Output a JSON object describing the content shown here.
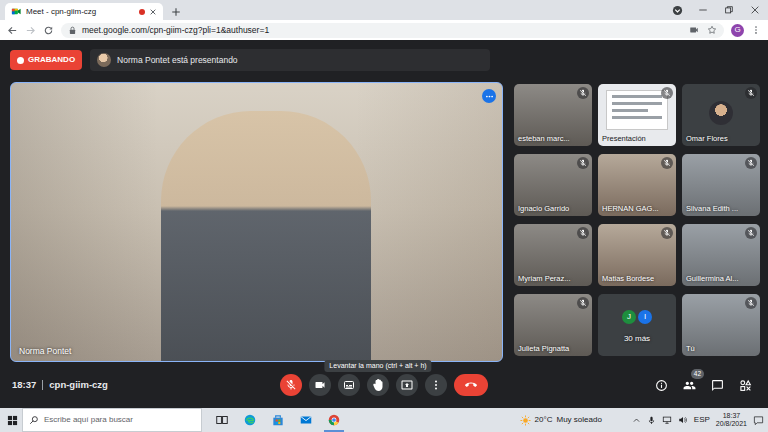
{
  "browser": {
    "tab": {
      "title": "Meet - cpn-giim-czg",
      "selected": true,
      "recording": true
    },
    "url": "meet.google.com/cpn-giim-czg?pli=1&authuser=1",
    "profile": "G"
  },
  "meeting": {
    "recording_label": "GRABANDO",
    "presenter_notice": "Norma Pontet está presentando",
    "main_video": {
      "name": "Norma Pontet"
    },
    "tiles": [
      {
        "name": "esteban marc...",
        "muted": true,
        "kind": "video"
      },
      {
        "name": "Presentación",
        "muted": true,
        "kind": "presentation"
      },
      {
        "name": "Omar Flores",
        "muted": true,
        "kind": "avatar"
      },
      {
        "name": "Ignacio Garrido",
        "muted": true,
        "kind": "video"
      },
      {
        "name": "HERNAN GAG...",
        "muted": true,
        "kind": "video"
      },
      {
        "name": "Silvana Edith ...",
        "muted": true,
        "kind": "video"
      },
      {
        "name": "Myriam Peraz...",
        "muted": true,
        "kind": "video"
      },
      {
        "name": "Matias Bordese",
        "muted": true,
        "kind": "video"
      },
      {
        "name": "Guillermina Al...",
        "muted": true,
        "kind": "video"
      },
      {
        "name": "Julieta Pignatta",
        "muted": true,
        "kind": "video"
      },
      {
        "name": "30 más",
        "muted": false,
        "kind": "more",
        "initials": [
          "J",
          "I"
        ]
      },
      {
        "name": "Tú",
        "muted": true,
        "kind": "video"
      }
    ],
    "time": "18:37",
    "code": "cpn-giim-czg",
    "controls": [
      {
        "kind": "mic",
        "on": false
      },
      {
        "kind": "camera",
        "on": true
      },
      {
        "kind": "captions"
      },
      {
        "kind": "hand",
        "tooltip": "Levantar la mano (ctrl + alt + h)"
      },
      {
        "kind": "present"
      },
      {
        "kind": "more"
      },
      {
        "kind": "hangup"
      }
    ],
    "side_controls": [
      {
        "kind": "info"
      },
      {
        "kind": "people",
        "badge": "42"
      },
      {
        "kind": "chat"
      },
      {
        "kind": "activities"
      }
    ]
  },
  "taskbar": {
    "search_placeholder": "Escribe aquí para buscar",
    "apps": [
      {
        "kind": "taskview",
        "open": false
      },
      {
        "kind": "edge",
        "open": false
      },
      {
        "kind": "store",
        "open": false
      },
      {
        "kind": "mail",
        "open": false
      },
      {
        "kind": "chrome",
        "open": true
      }
    ],
    "temperature": "20°C",
    "condition": "Muy soleado",
    "language": "ESP",
    "time": "18:37",
    "date": "20/8/2021"
  }
}
